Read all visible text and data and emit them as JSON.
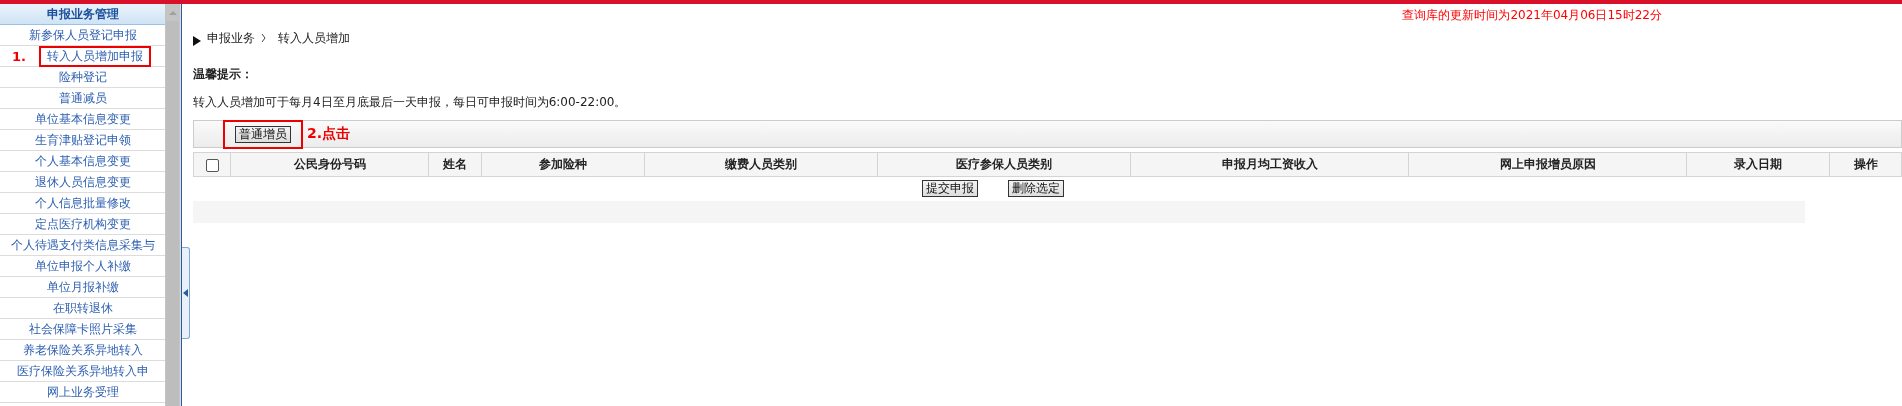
{
  "sidebar": {
    "title": "申报业务管理",
    "items": [
      {
        "label": "新参保人员登记申报"
      },
      {
        "label": "转入人员增加申报",
        "callout": "1."
      },
      {
        "label": "险种登记"
      },
      {
        "label": "普通减员"
      },
      {
        "label": "单位基本信息变更"
      },
      {
        "label": "生育津贴登记申领"
      },
      {
        "label": "个人基本信息变更"
      },
      {
        "label": "退休人员信息变更"
      },
      {
        "label": "个人信息批量修改"
      },
      {
        "label": "定点医疗机构变更"
      },
      {
        "label": "个人待遇支付类信息采集与"
      },
      {
        "label": "单位申报个人补缴"
      },
      {
        "label": "单位月报补缴"
      },
      {
        "label": "在职转退休"
      },
      {
        "label": "社会保障卡照片采集"
      },
      {
        "label": "养老保险关系异地转入"
      },
      {
        "label": "医疗保险关系异地转入申"
      },
      {
        "label": "网上业务受理"
      }
    ]
  },
  "update_notice": "查询库的更新时间为2021年04月06日15时22分",
  "breadcrumb": [
    "申报业务",
    "转入人员增加"
  ],
  "tip": {
    "title": "温馨提示：",
    "text": "转入人员增加可于每月4日至月底最后一天申报，每日可申报时间为6:00-22:00。"
  },
  "toolbar": {
    "button": "普通增员",
    "callout": "2.点击"
  },
  "table": {
    "select_all_checked": false,
    "columns": [
      "公民身份号码",
      "姓名",
      "参加险种",
      "缴费人员类别",
      "医疗参保人员类别",
      "申报月均工资收入",
      "网上申报增员原因",
      "录入日期",
      "操作"
    ]
  },
  "actions": [
    "提交申报",
    "删除选定"
  ]
}
